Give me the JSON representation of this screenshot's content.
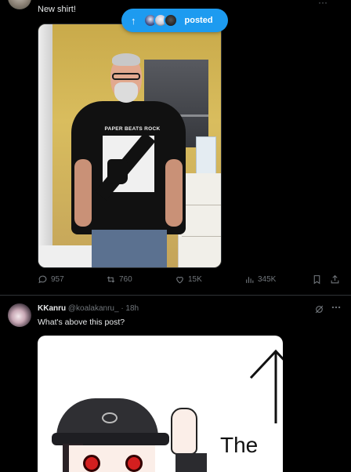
{
  "post1": {
    "text": "New shirt!",
    "shirt_text": "PAPER BEATS ROCK",
    "top_dots": "···",
    "stats": {
      "replies": "957",
      "reposts": "760",
      "likes": "15K",
      "views": "345K"
    }
  },
  "pill": {
    "arrow": "↑",
    "label": "posted"
  },
  "post2": {
    "display_name": "KKanru",
    "handle": "@koalakanru_",
    "time": "· 18h",
    "text": "What's above this post?",
    "card_text": "The"
  },
  "icons": {
    "reply": "reply-icon",
    "repost": "repost-icon",
    "like": "heart-icon",
    "views": "views-icon",
    "bookmark": "bookmark-icon",
    "share": "share-icon",
    "grok": "grok-icon",
    "more": "more-icon"
  },
  "colors": {
    "background": "#000000",
    "accent": "#1d9bf0",
    "muted": "#71767b",
    "text": "#e7e9ea",
    "divider": "#2f3336"
  }
}
